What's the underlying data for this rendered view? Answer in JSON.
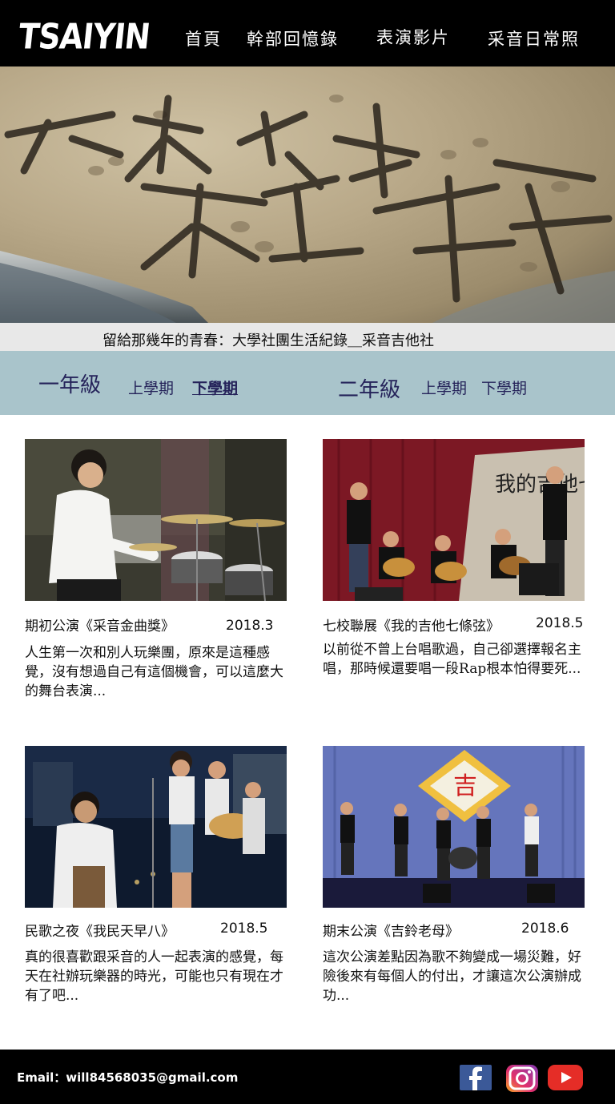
{
  "header": {
    "logo": "TSAIYIN",
    "nav": [
      "首頁",
      "幹部回憶錄",
      "表演影片",
      "采音日常照"
    ]
  },
  "hero": {
    "caption": "留給那幾年的青春：大學社團生活紀錄＿采音吉他社"
  },
  "tabs": {
    "year1": {
      "label": "一年級",
      "sem1": "上學期",
      "sem2": "下學期"
    },
    "year2": {
      "label": "二年級",
      "sem1": "上學期",
      "sem2": "下學期"
    }
  },
  "cards": [
    {
      "title": "期初公演《采音金曲獎》",
      "date": "2018.3",
      "desc": "人生第一次和別人玩樂團，原來是這種感覺，沒有想過自己有這個機會，可以這麼大的舞台表演..."
    },
    {
      "title": "七校聯展《我的吉他七條弦》",
      "date": "2018.5",
      "desc": "以前從不曾上台唱歌過，自己卻選擇報名主唱，那時候還要唱一段Rap根本怕得要死..."
    },
    {
      "title": "民歌之夜《我民天早八》",
      "date": "2018.5",
      "desc": "真的很喜歡跟采音的人一起表演的感覺，每天在社辦玩樂器的時光，可能也只有現在才有了吧..."
    },
    {
      "title": "期末公演《吉鈴老母》",
      "date": "2018.6",
      "desc": "這次公演差點因為歌不夠變成一場災難，好險後來有每個人的付出，才讓這次公演辦成功..."
    }
  ],
  "footer": {
    "email": "Email：will84568035@gmail.com",
    "social": [
      "facebook-icon",
      "instagram-icon",
      "youtube-icon"
    ],
    "colors": {
      "facebook": "#3b5998",
      "youtube": "#e52d27"
    }
  },
  "decor": {
    "poster_text": "我的吉他七條弦",
    "banner_char": "吉"
  }
}
